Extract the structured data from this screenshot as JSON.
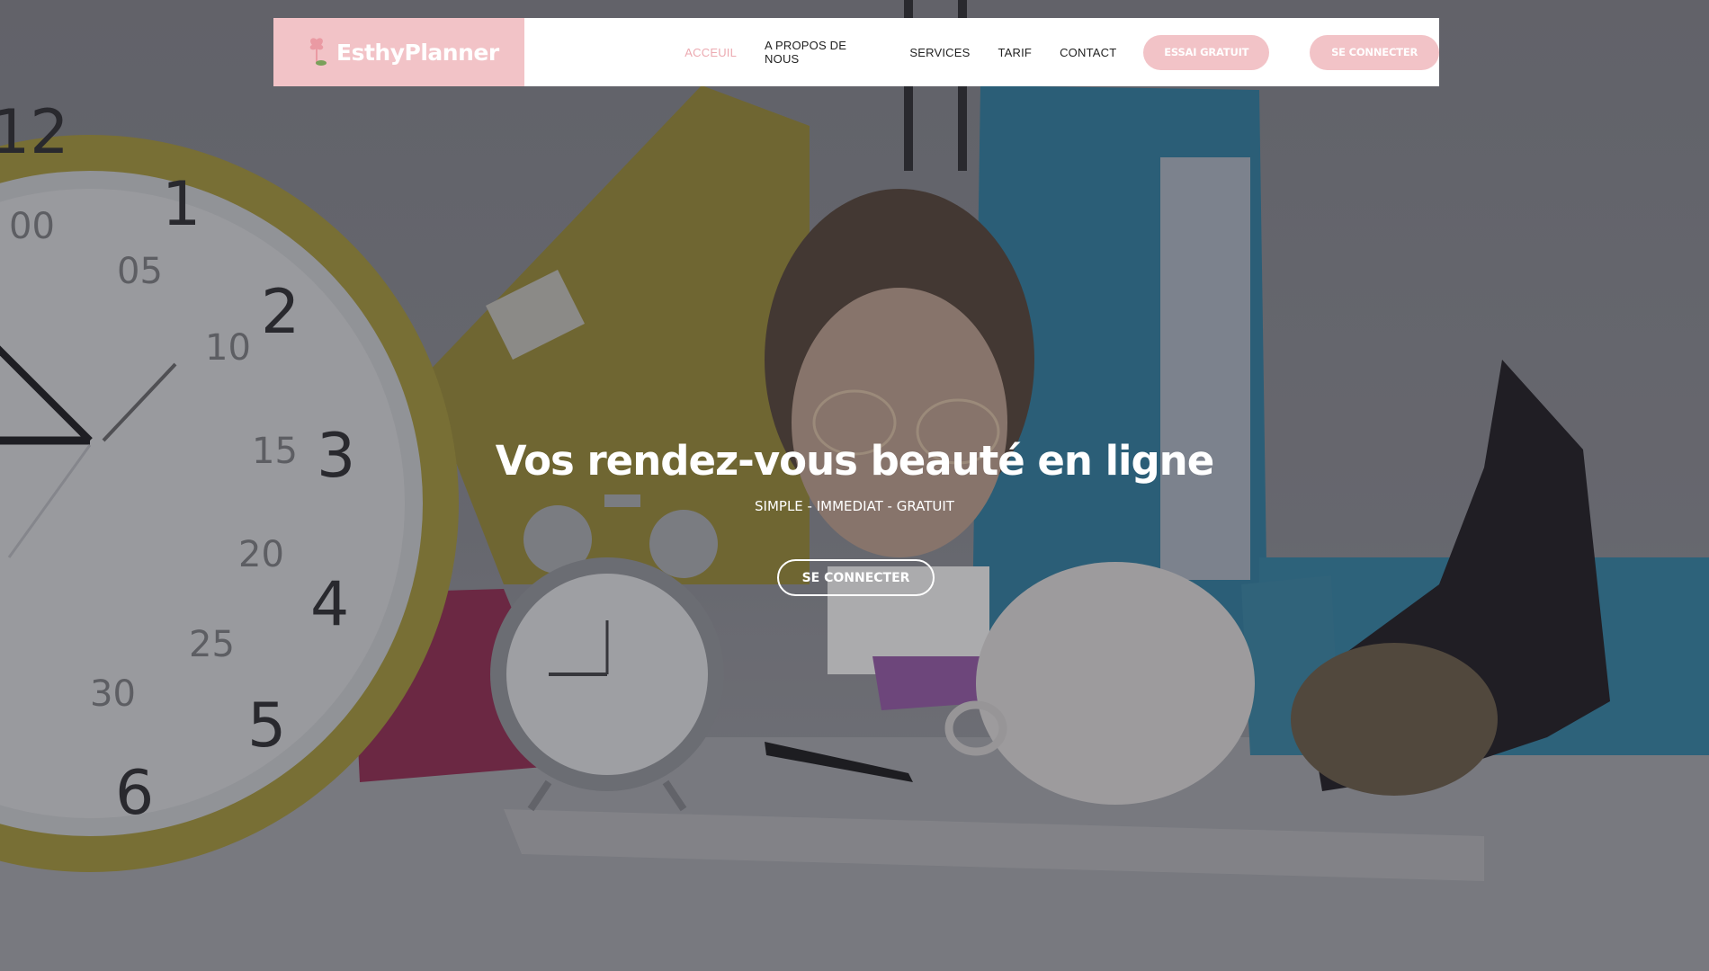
{
  "brand": {
    "name": "EsthyPlanner"
  },
  "nav": {
    "items": [
      {
        "label": "ACCEUIL",
        "active": true
      },
      {
        "label": "A PROPOS DE NOUS"
      },
      {
        "label": "SERVICES"
      },
      {
        "label": "TARIF"
      },
      {
        "label": "CONTACT"
      }
    ],
    "trial_button": "ESSAI GRATUIT",
    "login_button": "SE CONNECTER"
  },
  "hero": {
    "title": "Vos rendez-vous beauté en ligne",
    "subtitle": "SIMPLE - IMMEDIAT - GRATUIT",
    "cta": "SE CONNECTER",
    "wall_clock_numbers": [
      "12",
      "1",
      "2",
      "3",
      "4",
      "5",
      "6"
    ],
    "wall_clock_minutes": [
      "00",
      "05",
      "10",
      "15",
      "20",
      "25",
      "30"
    ]
  },
  "colors": {
    "brand_pink": "#f2c3c7",
    "active_link": "#ecaab1",
    "white": "#ffffff"
  }
}
